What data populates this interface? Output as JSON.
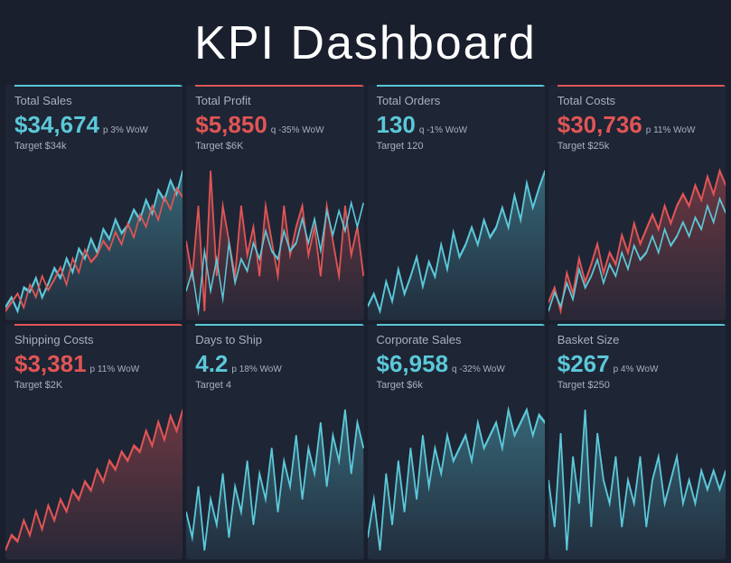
{
  "header": {
    "title": "KPI Dashboard"
  },
  "cards": [
    {
      "id": "total-sales",
      "title": "Total Sales",
      "value": "$34,674",
      "valueColor": "cyan",
      "badge": "p 3% WoW",
      "target": "Target $34k",
      "barColor": "cyan",
      "chartType": "dual",
      "primaryColor": "#5bc8d8",
      "secondaryColor": "#e05555"
    },
    {
      "id": "total-profit",
      "title": "Total Profit",
      "value": "$5,850",
      "valueColor": "red",
      "badge": "q -35% WoW",
      "target": "Target $6K",
      "barColor": "red",
      "chartType": "dual",
      "primaryColor": "#e05555",
      "secondaryColor": "#5bc8d8"
    },
    {
      "id": "total-orders",
      "title": "Total Orders",
      "value": "130",
      "valueColor": "cyan",
      "badge": "q -1% WoW",
      "target": "Target 120",
      "barColor": "cyan",
      "chartType": "single",
      "primaryColor": "#5bc8d8"
    },
    {
      "id": "total-costs",
      "title": "Total Costs",
      "value": "$30,736",
      "valueColor": "red",
      "badge": "p 11% WoW",
      "target": "Target $25k",
      "barColor": "red",
      "chartType": "dual",
      "primaryColor": "#e05555",
      "secondaryColor": "#5bc8d8"
    },
    {
      "id": "shipping-costs",
      "title": "Shipping Costs",
      "value": "$3,381",
      "valueColor": "red",
      "badge": "p 11% WoW",
      "target": "Target $2K",
      "barColor": "red",
      "chartType": "single",
      "primaryColor": "#e05555"
    },
    {
      "id": "days-to-ship",
      "title": "Days to Ship",
      "value": "4.2",
      "valueColor": "cyan",
      "badge": "p 18% WoW",
      "target": "Target 4",
      "barColor": "cyan",
      "chartType": "single",
      "primaryColor": "#5bc8d8"
    },
    {
      "id": "corporate-sales",
      "title": "Corporate Sales",
      "value": "$6,958",
      "valueColor": "cyan",
      "badge": "q -32% WoW",
      "target": "Target $6k",
      "barColor": "cyan",
      "chartType": "single",
      "primaryColor": "#5bc8d8"
    },
    {
      "id": "basket-size",
      "title": "Basket Size",
      "value": "$267",
      "valueColor": "cyan",
      "badge": "p 4% WoW",
      "target": "Target $250",
      "barColor": "cyan",
      "chartType": "single",
      "primaryColor": "#5bc8d8"
    }
  ]
}
